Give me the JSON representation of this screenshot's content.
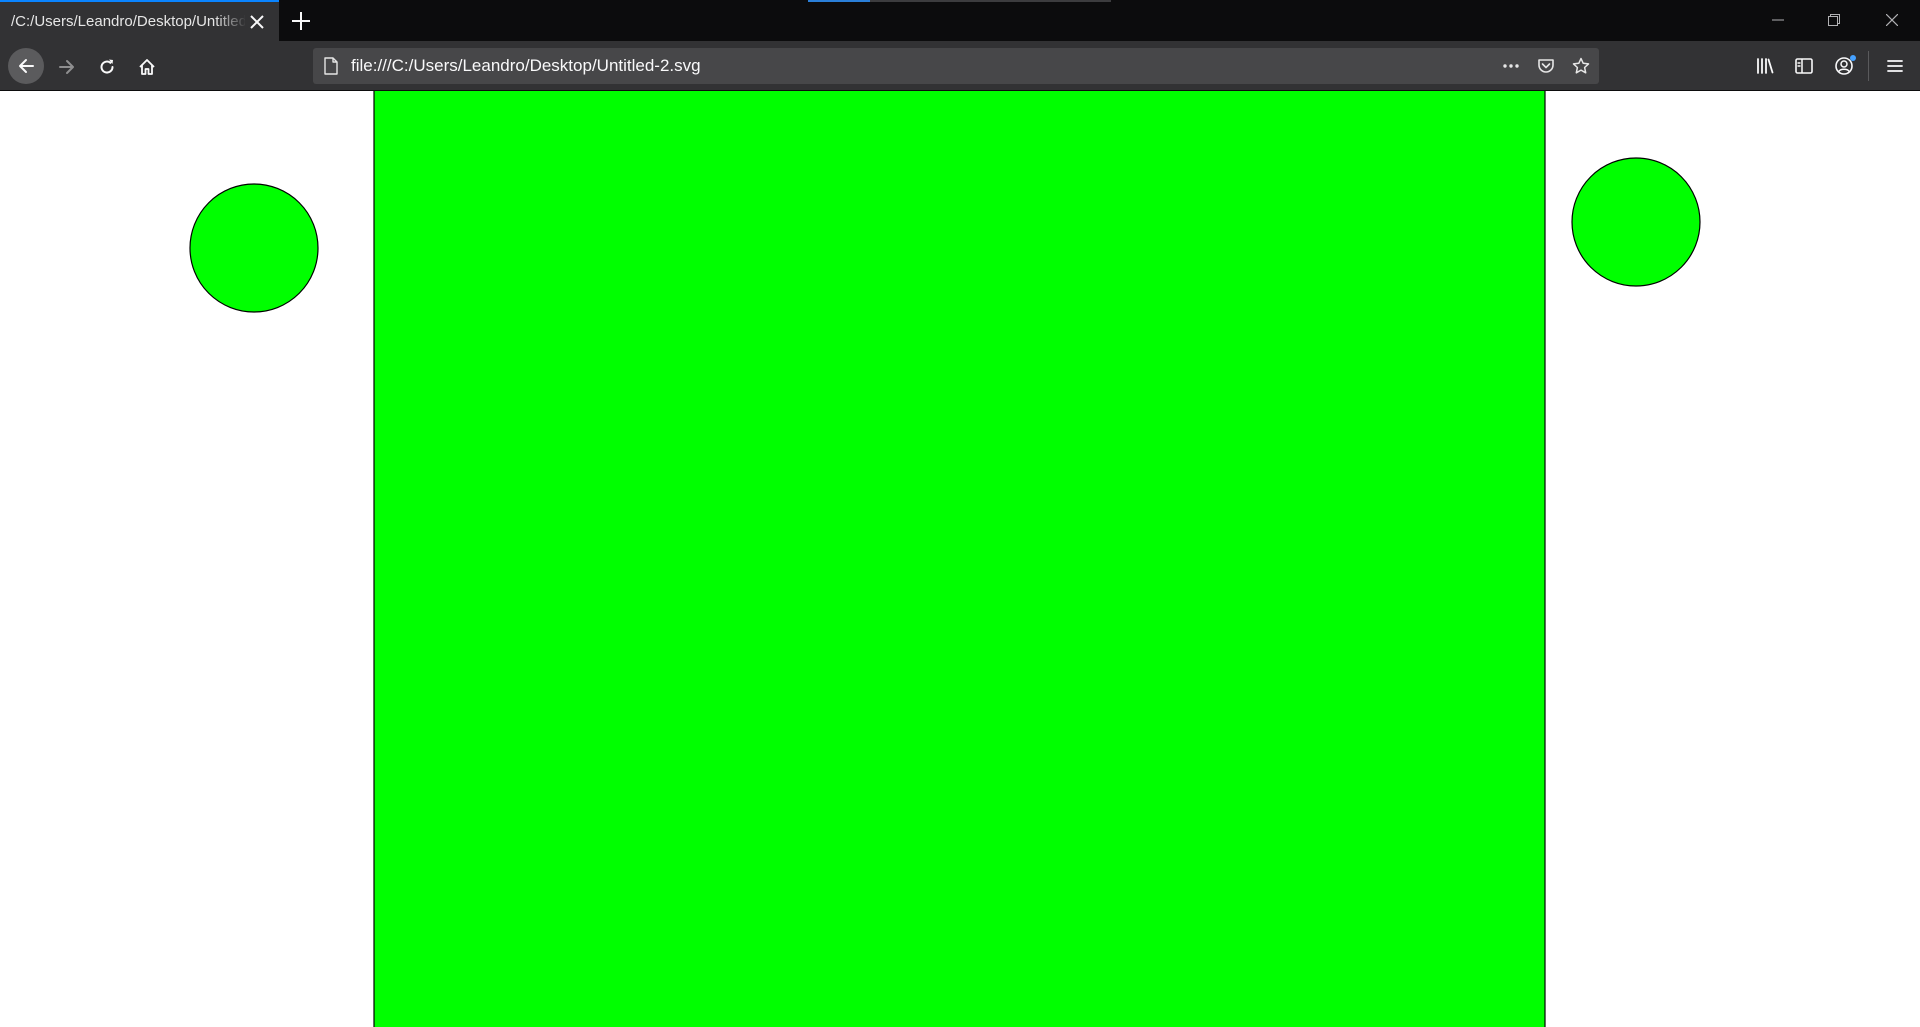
{
  "tab": {
    "title": "/C:/Users/Leandro/Desktop/Untitled-2.svg",
    "close_icon": "close-icon",
    "new_tab_icon": "plus-icon"
  },
  "window_controls": {
    "minimize_icon": "minimize-icon",
    "restore_icon": "restore-icon",
    "close_icon": "close-icon"
  },
  "navigation": {
    "back_icon": "arrow-left-icon",
    "forward_icon": "arrow-right-icon",
    "reload_icon": "reload-icon",
    "home_icon": "home-icon"
  },
  "urlbar": {
    "url": "file:///C:/Users/Leandro/Desktop/Untitled-2.svg",
    "page_icon": "page-icon",
    "more_icon": "ellipsis-icon",
    "pocket_icon": "pocket-icon",
    "bookmark_icon": "star-icon"
  },
  "toolbar": {
    "library_icon": "library-icon",
    "sidebar_icon": "sidebar-icon",
    "account_icon": "account-icon",
    "menu_icon": "hamburger-menu-icon"
  },
  "colors": {
    "shape_fill": "#00ff00",
    "shape_stroke": "#000000",
    "tab_accent": "#0a84ff",
    "chrome_dark": "#0c0c0d",
    "chrome_toolbar": "#323234",
    "urlbar_bg": "#474749"
  },
  "document": {
    "shapes": [
      "rectangle",
      "circle",
      "circle"
    ]
  }
}
